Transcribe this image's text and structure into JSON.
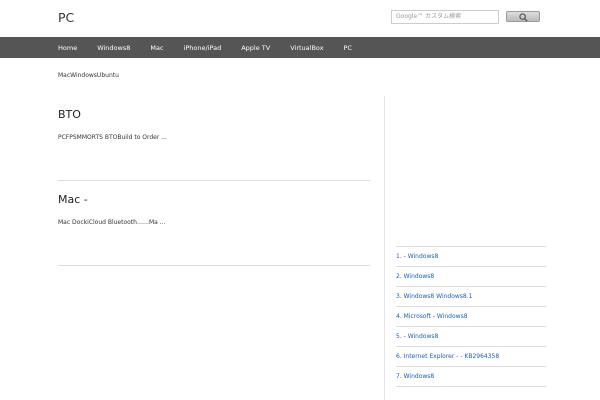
{
  "header": {
    "logo_main": "PC",
    "logo_accent": "",
    "search_placeholder": "Google™ カスタム検索"
  },
  "nav": {
    "items": [
      "Home",
      "Windows8",
      "Mac",
      "iPhone/iPad",
      "Apple TV",
      "VirtualBox",
      "PC"
    ]
  },
  "tagline": "MacWindowsUbuntu",
  "articles": [
    {
      "title": "BTO",
      "excerpt": "PCFPSMMORTS BTOBuild to Order ..."
    },
    {
      "title": "Mac - ",
      "excerpt": "Mac DockiCloud Bluetooth……Ma ..."
    }
  ],
  "pagination_label": "",
  "sidebar": {
    "title": "",
    "ranking": [
      "1. - Windows8",
      "2. Windows8",
      "3. Windows8 Windows8.1",
      "4. Microsoft - Windows8",
      "5. - Windows8",
      "6. Internet Explorer - - KB2964358",
      "7. Windows8"
    ]
  }
}
